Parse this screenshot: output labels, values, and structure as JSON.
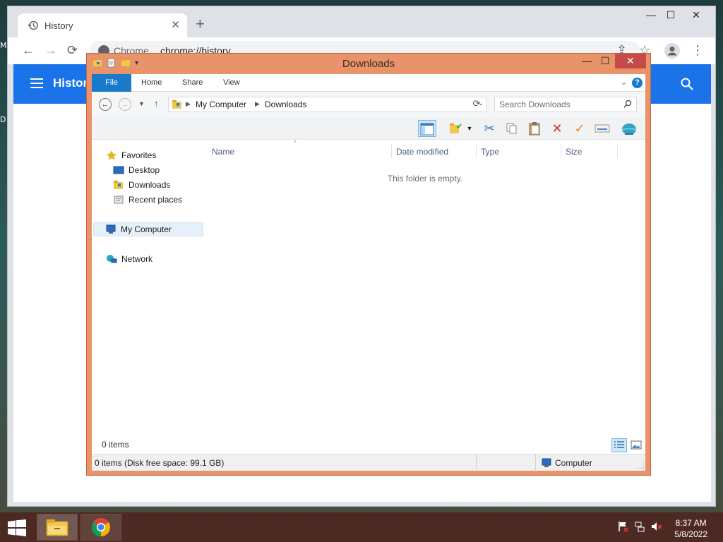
{
  "desktop": {
    "edge_text_1": "M",
    "edge_text_2": "D"
  },
  "chrome": {
    "tab": {
      "title": "History",
      "icon": "history-icon"
    },
    "controls": {
      "minimize": "—",
      "maximize": "☐",
      "close": "✕",
      "new_tab": "+"
    },
    "nav": {
      "back": "←",
      "forward": "→",
      "reload": "⟳",
      "share": "⇪",
      "bookmark": "☆",
      "menu": "⋮"
    },
    "omnibox": {
      "scheme": "Chrome",
      "url": "chrome://history"
    },
    "page": {
      "title": "History"
    }
  },
  "explorer": {
    "title": "Downloads",
    "controls": {
      "minimize": "—",
      "maximize": "☐",
      "close": "✕"
    },
    "ribbon": {
      "tabs": [
        "File",
        "Home",
        "Share",
        "View"
      ],
      "help": "?"
    },
    "address": {
      "crumbs": [
        "My Computer",
        "Downloads"
      ],
      "search_placeholder": "Search Downloads"
    },
    "nav_pane": {
      "favorites": "Favorites",
      "favorites_items": [
        "Desktop",
        "Downloads",
        "Recent places"
      ],
      "computer": "My Computer",
      "network": "Network"
    },
    "columns": [
      "Name",
      "Date modified",
      "Type",
      "Size"
    ],
    "empty_message": "This folder is empty.",
    "item_count": "0 items",
    "status": {
      "left": "0 items (Disk free space: 99.1 GB)",
      "right": "Computer"
    }
  },
  "taskbar": {
    "apps": [
      "File Explorer",
      "Google Chrome"
    ],
    "time": "8:37 AM",
    "date": "5/8/2022"
  },
  "colors": {
    "explorer_frame": "#e8936a",
    "close_button": "#c74a4a",
    "chrome_accent": "#1a73e8",
    "file_tab": "#1979ca",
    "taskbar": "#4c2a23"
  }
}
